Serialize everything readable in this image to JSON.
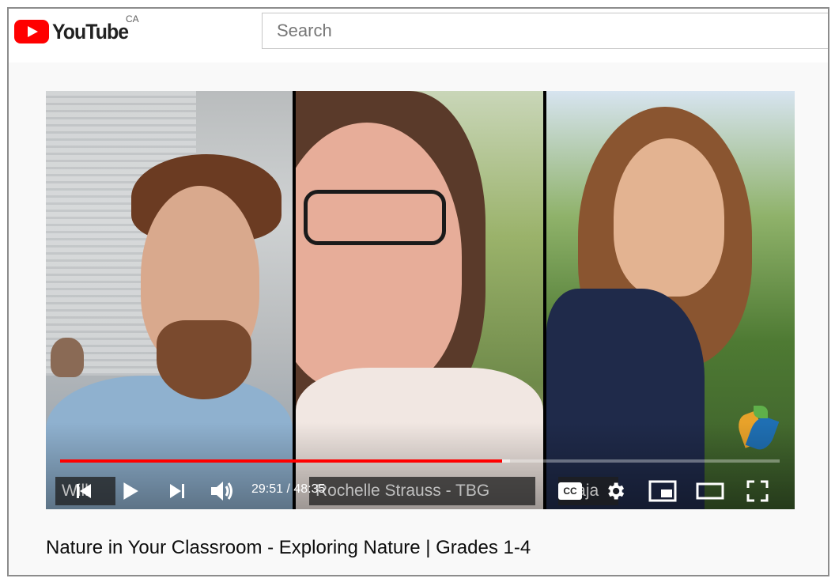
{
  "masthead": {
    "logo_text": "YouTube",
    "region": "CA",
    "search_placeholder": "Search"
  },
  "player": {
    "participants": [
      "Will",
      "Rochelle Strauss - TBG",
      "Raja"
    ],
    "current_time": "29:51",
    "duration": "48:35",
    "time_display": "29:51 / 48:35",
    "progress_played_fraction": 0.614,
    "progress_loaded_fraction": 0.625
  },
  "video": {
    "title": "Nature in Your Classroom - Exploring Nature | Grades 1-4"
  },
  "colors": {
    "brand_red": "#ff0000",
    "progress_red": "#ff0000"
  },
  "icons": [
    "youtube-logo-icon",
    "previous-icon",
    "play-icon",
    "next-icon",
    "volume-icon",
    "captions-icon",
    "settings-icon",
    "miniplayer-icon",
    "theater-mode-icon",
    "fullscreen-icon"
  ]
}
